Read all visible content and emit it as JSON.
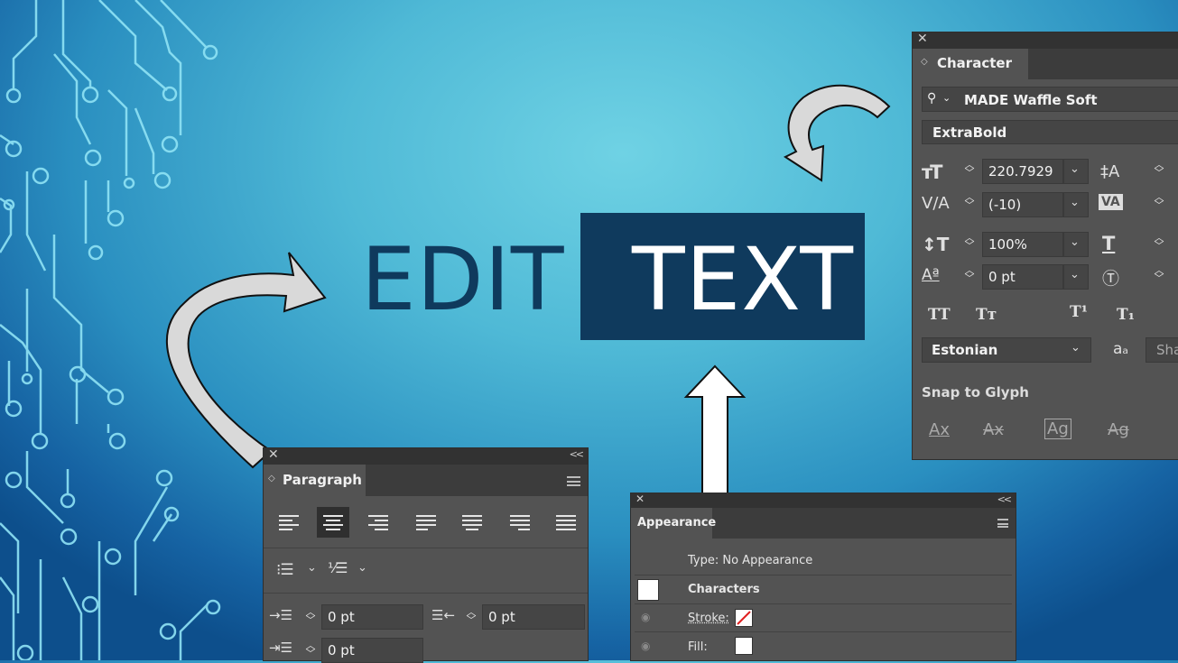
{
  "headline": {
    "word1": "EDIT",
    "word2": "TEXT"
  },
  "colors": {
    "navy": "#0f3a5d",
    "panel": "#535353",
    "panel_header": "#3c3c3c"
  },
  "character_panel": {
    "title": "Character",
    "font_family": "MADE Waffle Soft",
    "font_style": "ExtraBold",
    "font_size": "220.7929",
    "kerning": "(-10)",
    "vertical_scale": "100%",
    "baseline_shift": "0 pt",
    "language": "Estonian",
    "sharpen_label": "Sha",
    "snap_label": "Snap to Glyph"
  },
  "paragraph_panel": {
    "title": "Paragraph",
    "left_indent": "0 pt",
    "right_indent": "0 pt",
    "first_line_indent": "0 pt"
  },
  "appearance_panel": {
    "title": "Appearance",
    "type_label": "Type: No Appearance",
    "characters_label": "Characters",
    "stroke_label": "Stroke:",
    "fill_label": "Fill:"
  }
}
